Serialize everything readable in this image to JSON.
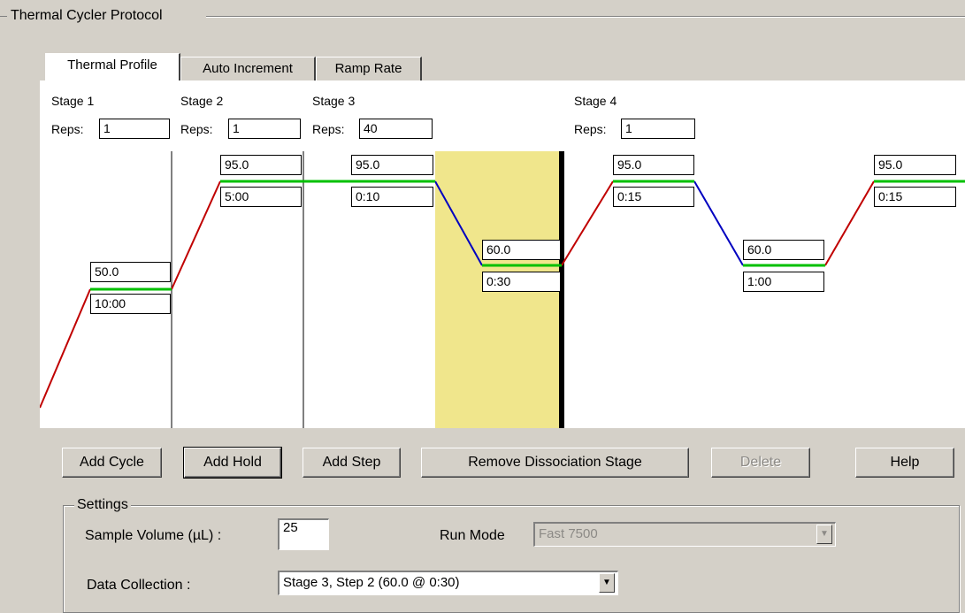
{
  "group_title": "Thermal Cycler Protocol",
  "tabs": [
    {
      "label": "Thermal Profile",
      "active": true
    },
    {
      "label": "Auto Increment",
      "active": false
    },
    {
      "label": "Ramp Rate",
      "active": false
    }
  ],
  "stages": [
    {
      "label": "Stage 1",
      "reps_label": "Reps:",
      "reps": "1"
    },
    {
      "label": "Stage 2",
      "reps_label": "Reps:",
      "reps": "1"
    },
    {
      "label": "Stage 3",
      "reps_label": "Reps:",
      "reps": "40"
    },
    {
      "label": "Stage 4",
      "reps_label": "Reps:",
      "reps": "1"
    }
  ],
  "steps": [
    {
      "temp": "50.0",
      "time": "10:00"
    },
    {
      "temp": "95.0",
      "time": "5:00"
    },
    {
      "temp": "95.0",
      "time": "0:10"
    },
    {
      "temp": "60.0",
      "time": "0:30"
    },
    {
      "temp": "95.0",
      "time": "0:15"
    },
    {
      "temp": "60.0",
      "time": "1:00"
    },
    {
      "temp": "95.0",
      "time": "0:15"
    }
  ],
  "colors": {
    "ramp_up": "#c00000",
    "ramp_down": "#0000c0",
    "hold": "#00c000",
    "highlight": "#f0e68c"
  },
  "buttons": {
    "add_cycle": "Add Cycle",
    "add_hold": "Add Hold",
    "add_step": "Add Step",
    "remove_dissociation": "Remove Dissociation Stage",
    "delete": "Delete",
    "help": "Help"
  },
  "settings": {
    "title": "Settings",
    "sample_volume_label": "Sample Volume (µL) :",
    "sample_volume": "25",
    "run_mode_label": "Run Mode",
    "run_mode": "Fast 7500",
    "data_collection_label": "Data Collection :",
    "data_collection": "Stage 3, Step 2 (60.0 @ 0:30)"
  }
}
